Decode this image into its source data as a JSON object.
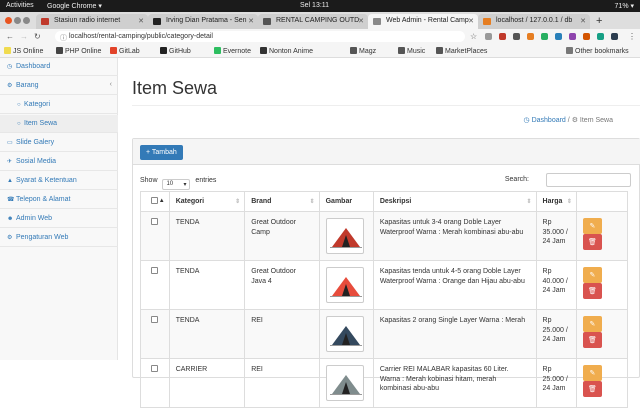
{
  "system": {
    "activities": "Activities",
    "app": "Google Chrome ▾",
    "clock": "Sel 13:11",
    "battery": "71% ▾"
  },
  "tabs": [
    {
      "label": "Stasiun radio internet",
      "color": "#c0392b"
    },
    {
      "label": "Irving Dian Pratama - Sen",
      "color": "#222222"
    },
    {
      "label": "RENTAL CAMPING OUTD",
      "color": "#555555"
    },
    {
      "label": "Web Admin - Rental Camp",
      "color": "#888888",
      "active": true
    },
    {
      "label": "localhost / 127.0.0.1 / db",
      "color": "#e67e22"
    }
  ],
  "address": {
    "url": "localhost/rental-camping/public/category-detail"
  },
  "bookmarks": [
    {
      "label": "JS Online",
      "color": "#f0db4f"
    },
    {
      "label": "PHP Online",
      "color": "#444444"
    },
    {
      "label": "GitLab",
      "color": "#e24329"
    },
    {
      "label": "GitHub",
      "color": "#222222"
    },
    {
      "label": "Evernote",
      "color": "#2dbe60"
    },
    {
      "label": "Nonton Anime",
      "color": "#333333"
    },
    {
      "label": "Magz",
      "color": "#555555"
    },
    {
      "label": "Music",
      "color": "#555555"
    },
    {
      "label": "MarketPlaces",
      "color": "#555555"
    }
  ],
  "other_bookmarks": "Other bookmarks",
  "sidebar": {
    "items": [
      {
        "label": "Dashboard",
        "icon": "dashboard-icon",
        "glyph": "◷"
      },
      {
        "label": "Barang",
        "icon": "barang-icon",
        "glyph": "⚙",
        "caret": "‹"
      },
      {
        "label": "Kategori",
        "icon": "circle-icon",
        "glyph": "○",
        "sub": true
      },
      {
        "label": "Item Sewa",
        "icon": "circle-icon",
        "glyph": "○",
        "sub": true,
        "active": true
      },
      {
        "label": "Slide Galery",
        "icon": "image-icon",
        "glyph": "▭"
      },
      {
        "label": "Sosial Media",
        "icon": "twitter-icon",
        "glyph": "✈"
      },
      {
        "label": "Syarat & Ketentuan",
        "icon": "warning-icon",
        "glyph": "▲"
      },
      {
        "label": "Telepon & Alamat",
        "icon": "phone-icon",
        "glyph": "☎"
      },
      {
        "label": "Admin Web",
        "icon": "users-icon",
        "glyph": "☻"
      },
      {
        "label": "Pengaturan Web",
        "icon": "settings-icon",
        "glyph": "⚙"
      }
    ]
  },
  "page": {
    "title": "Item Sewa",
    "breadcrumb": {
      "home": "Dashboard",
      "sep": "/",
      "current": "Item Sewa"
    }
  },
  "table_ctrl": {
    "add_label": "+ Tambah",
    "show": "Show",
    "entries_value": "10",
    "entries": "entries",
    "search": "Search:"
  },
  "columns": [
    "Kategori",
    "Brand",
    "Gambar",
    "Deskripsi",
    "Harga"
  ],
  "rows": [
    {
      "kategori": "TENDA",
      "brand": "Great Outdoor Camp",
      "desc": "Kapasitas untuk 3-4 orang Doble Layer Waterproof Warna : Merah kombinasi abu-abu",
      "harga": "Rp 35.000 / 24 Jam",
      "tent": "#c0392b"
    },
    {
      "kategori": "TENDA",
      "brand": "Great Outdoor Java 4",
      "desc": "Kapasitas tenda untuk 4-5 orang Doble Layer Waterproof Warna : Orange dan Hijau abu-abu",
      "harga": "Rp 40.000 / 24 Jam",
      "tent": "#e74c3c"
    },
    {
      "kategori": "TENDA",
      "brand": "REI",
      "desc": "Kapasitas 2 orang Single Layer Warna : Merah",
      "harga": "Rp 25.000 / 24 Jam",
      "tent": "#34495e"
    },
    {
      "kategori": "CARRIER",
      "brand": "REI",
      "desc": "Carrier REI MALABAR kapasitas 60 Liter. Warna : Merah kobinasi hitam, merah kombinasi abu-abu",
      "harga": "Rp 25.000 / 24 Jam",
      "tent": "#7f8c8d"
    }
  ]
}
